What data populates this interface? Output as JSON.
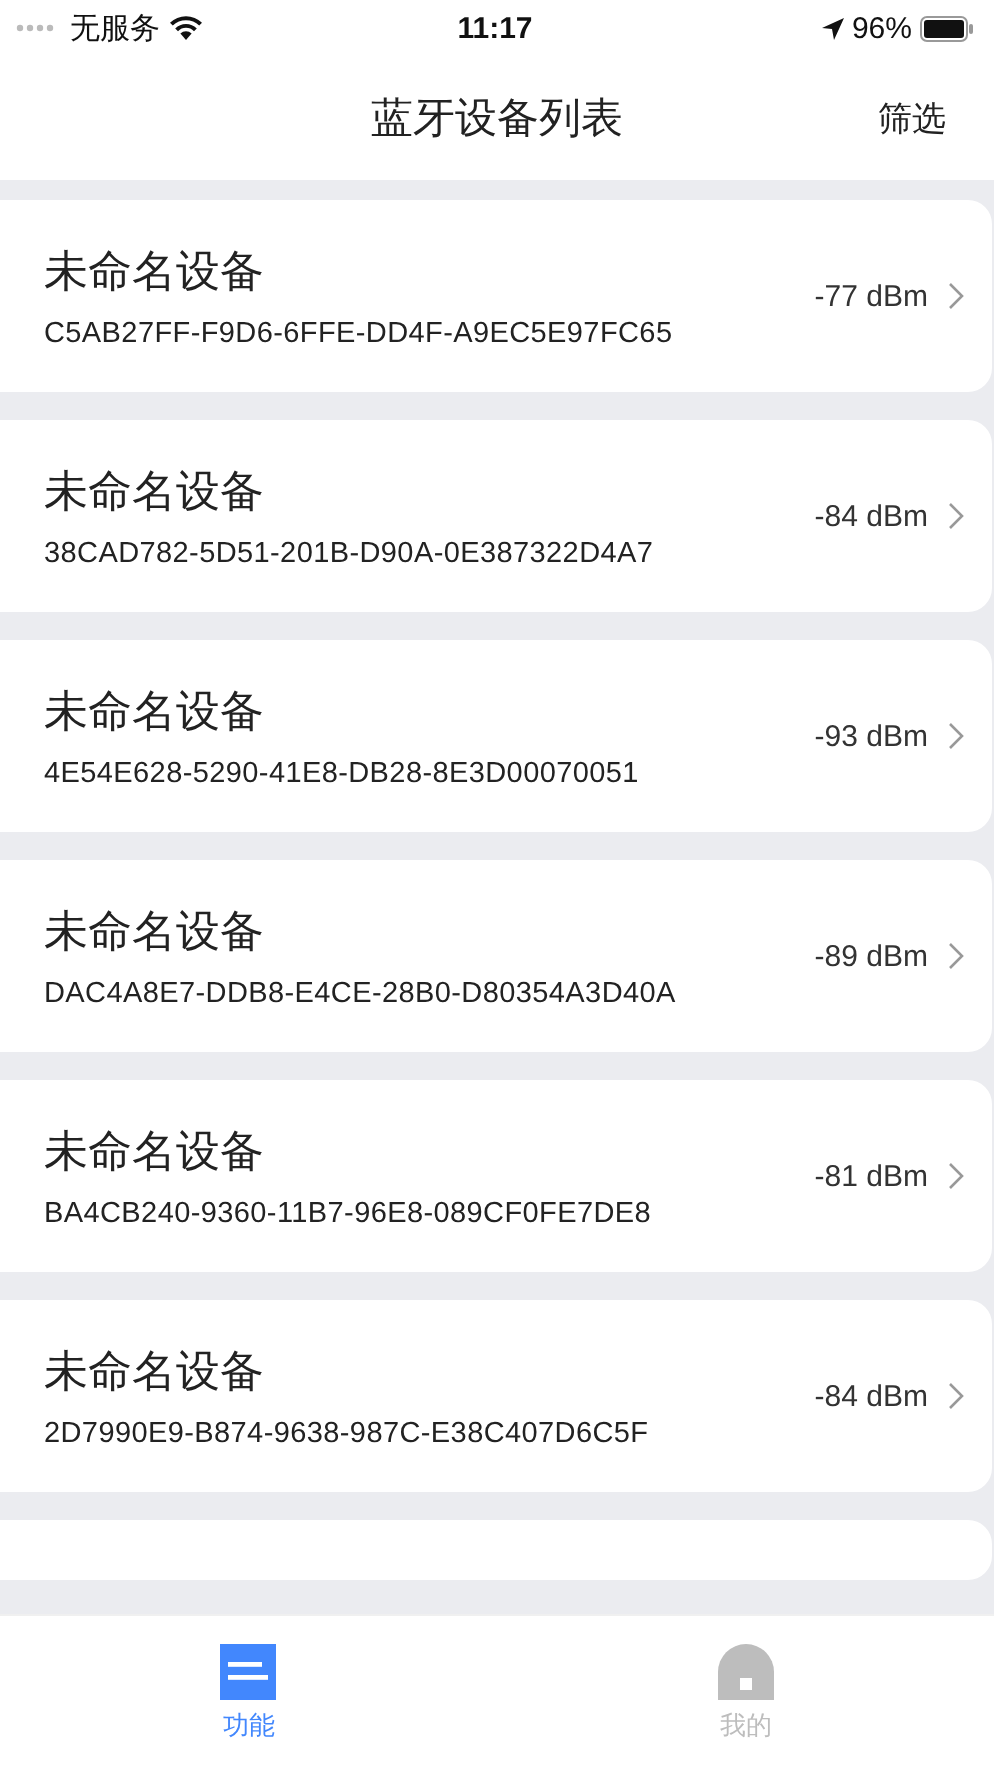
{
  "status_bar": {
    "carrier": "无服务",
    "time": "11:17",
    "battery": "96%"
  },
  "nav": {
    "title": "蓝牙设备列表",
    "action": "筛选"
  },
  "devices": [
    {
      "name": "未命名设备",
      "id": "C5AB27FF-F9D6-6FFE-DD4F-A9EC5E97FC65",
      "rssi": "-77 dBm"
    },
    {
      "name": "未命名设备",
      "id": "38CAD782-5D51-201B-D90A-0E387322D4A7",
      "rssi": "-84 dBm"
    },
    {
      "name": "未命名设备",
      "id": "4E54E628-5290-41E8-DB28-8E3D00070051",
      "rssi": "-93 dBm"
    },
    {
      "name": "未命名设备",
      "id": "DAC4A8E7-DDB8-E4CE-28B0-D80354A3D40A",
      "rssi": "-89 dBm"
    },
    {
      "name": "未命名设备",
      "id": "BA4CB240-9360-11B7-96E8-089CF0FE7DE8",
      "rssi": "-81 dBm"
    },
    {
      "name": "未命名设备",
      "id": "2D7990E9-B874-9638-987C-E38C407D6C5F",
      "rssi": "-84 dBm"
    }
  ],
  "tabs": [
    {
      "label": "功能",
      "kind": "list",
      "selected": true
    },
    {
      "label": "我的",
      "kind": "person",
      "selected": false
    }
  ]
}
